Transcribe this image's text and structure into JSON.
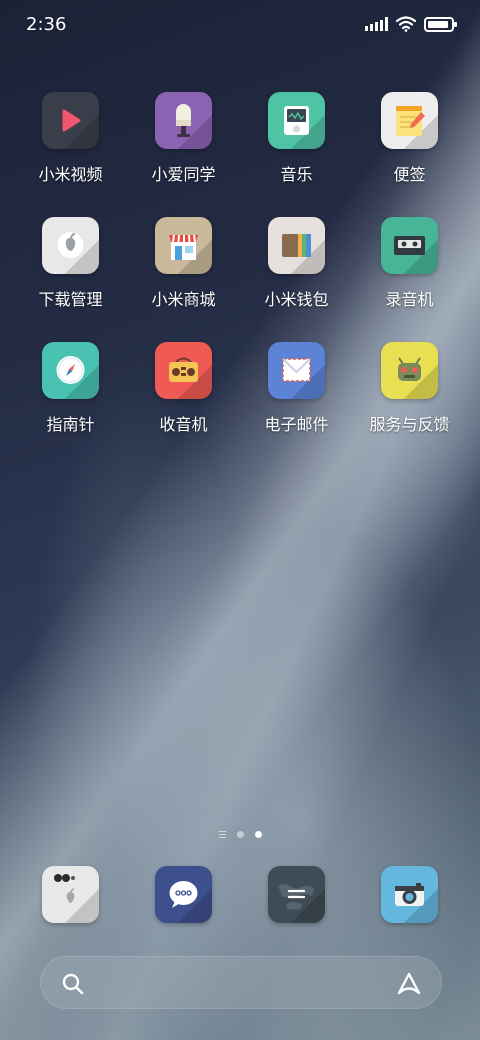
{
  "status_bar": {
    "time": "2:36",
    "icons": [
      "signal-icon",
      "wifi-icon",
      "battery-icon"
    ]
  },
  "apps": [
    {
      "label": "小米视频",
      "icon": "video-play-icon",
      "color": "#3a3e4a"
    },
    {
      "label": "小爱同学",
      "icon": "microphone-icon",
      "color": "#8c62b4"
    },
    {
      "label": "音乐",
      "icon": "music-player-icon",
      "color": "#4fc4a4"
    },
    {
      "label": "便签",
      "icon": "notepad-icon",
      "color": "#eeeeee"
    },
    {
      "label": "下载管理",
      "icon": "apple-download-icon",
      "color": "#e8e8e8"
    },
    {
      "label": "小米商城",
      "icon": "mi-shop-icon",
      "color": "#c9b99a"
    },
    {
      "label": "小米钱包",
      "icon": "wallet-icon",
      "color": "#e6e0dc"
    },
    {
      "label": "录音机",
      "icon": "cassette-icon",
      "color": "#48b596"
    },
    {
      "label": "指南针",
      "icon": "compass-icon",
      "color": "#49c2b2"
    },
    {
      "label": "收音机",
      "icon": "radio-icon",
      "color": "#f05a54"
    },
    {
      "label": "电子邮件",
      "icon": "mail-icon",
      "color": "#5b83d6"
    },
    {
      "label": "服务与反馈",
      "icon": "feedback-robot-icon",
      "color": "#e8e052"
    }
  ],
  "page_indicator": {
    "pages": 2,
    "active": 2
  },
  "dock": [
    {
      "name": "dock-camera-lens-app",
      "icon": "apple-lens-icon",
      "color": "#e8e8e8"
    },
    {
      "name": "dock-messages-app",
      "icon": "chat-bubble-icon",
      "color": "#3e4f8e"
    },
    {
      "name": "dock-browser-app",
      "icon": "globe-map-icon",
      "color": "#3f4b55"
    },
    {
      "name": "dock-camera-app",
      "icon": "camera-icon",
      "color": "#65b7de"
    }
  ],
  "search_bar": {
    "left_icon": "search-icon",
    "right_icon": "assistant-a-icon"
  }
}
